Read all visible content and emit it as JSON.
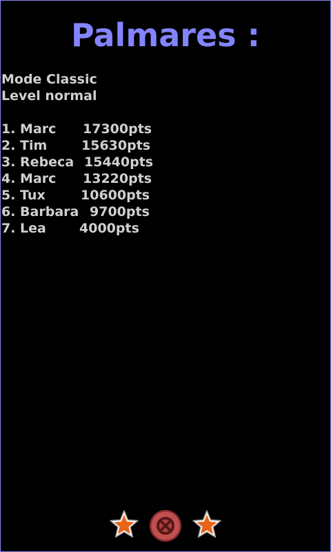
{
  "title": "Palmares :",
  "mode_line": "Mode Classic",
  "level_line": "Level normal",
  "scores": [
    {
      "rank_name": "1. Marc",
      "points": "17300pts"
    },
    {
      "rank_name": "2. Tim",
      "points": "15630pts"
    },
    {
      "rank_name": "3. Rebeca",
      "points": "15440pts"
    },
    {
      "rank_name": "4. Marc",
      "points": "13220pts"
    },
    {
      "rank_name": "5. Tux",
      "points": "10600pts"
    },
    {
      "rank_name": "6. Barbara",
      "points": "9700pts"
    },
    {
      "rank_name": "7. Lea",
      "points": "4000pts"
    }
  ],
  "bottom_icons": [
    {
      "icon": "star-icon",
      "color": "#e8641a"
    },
    {
      "icon": "close-icon",
      "color": "#b04040"
    },
    {
      "icon": "star-icon",
      "color": "#e8641a"
    }
  ],
  "colors": {
    "title": "#8484ff",
    "text": "#d0d0d0",
    "background": "#000000",
    "border": "#8888ee"
  }
}
